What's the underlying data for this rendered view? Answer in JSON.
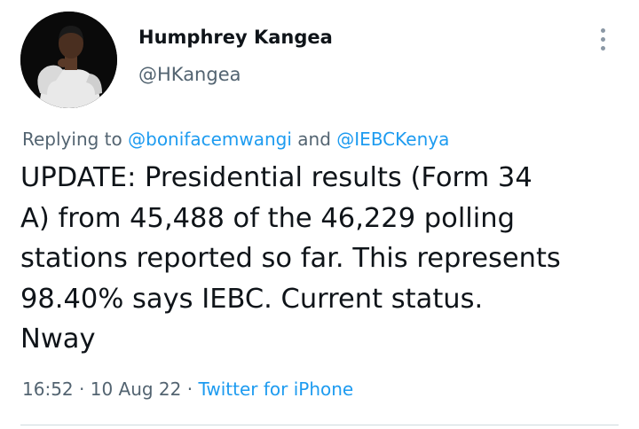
{
  "author": {
    "name": "Humphrey Kangea",
    "handle": "@HKangea"
  },
  "reply_context": {
    "prefix": "Replying to",
    "mention_1": "@bonifacemwangi",
    "conjunction": "and",
    "mention_2": "@IEBCKenya"
  },
  "tweet": {
    "text": "UPDATE: Presidential results (Form 34\nA) from 45,488 of the 46,229 polling\nstations reported so far. This represents\n98.40% says IEBC. Current status.\nNway"
  },
  "meta": {
    "time": "16:52",
    "separator_1": "·",
    "date": "10 Aug 22",
    "separator_2": "·",
    "source": "Twitter for iPhone"
  },
  "icons": {
    "more": "more-vertical-icon"
  },
  "colors": {
    "text": "#0f1419",
    "secondary": "#536471",
    "link": "#1d9bf0",
    "divider": "#cfd9de"
  }
}
